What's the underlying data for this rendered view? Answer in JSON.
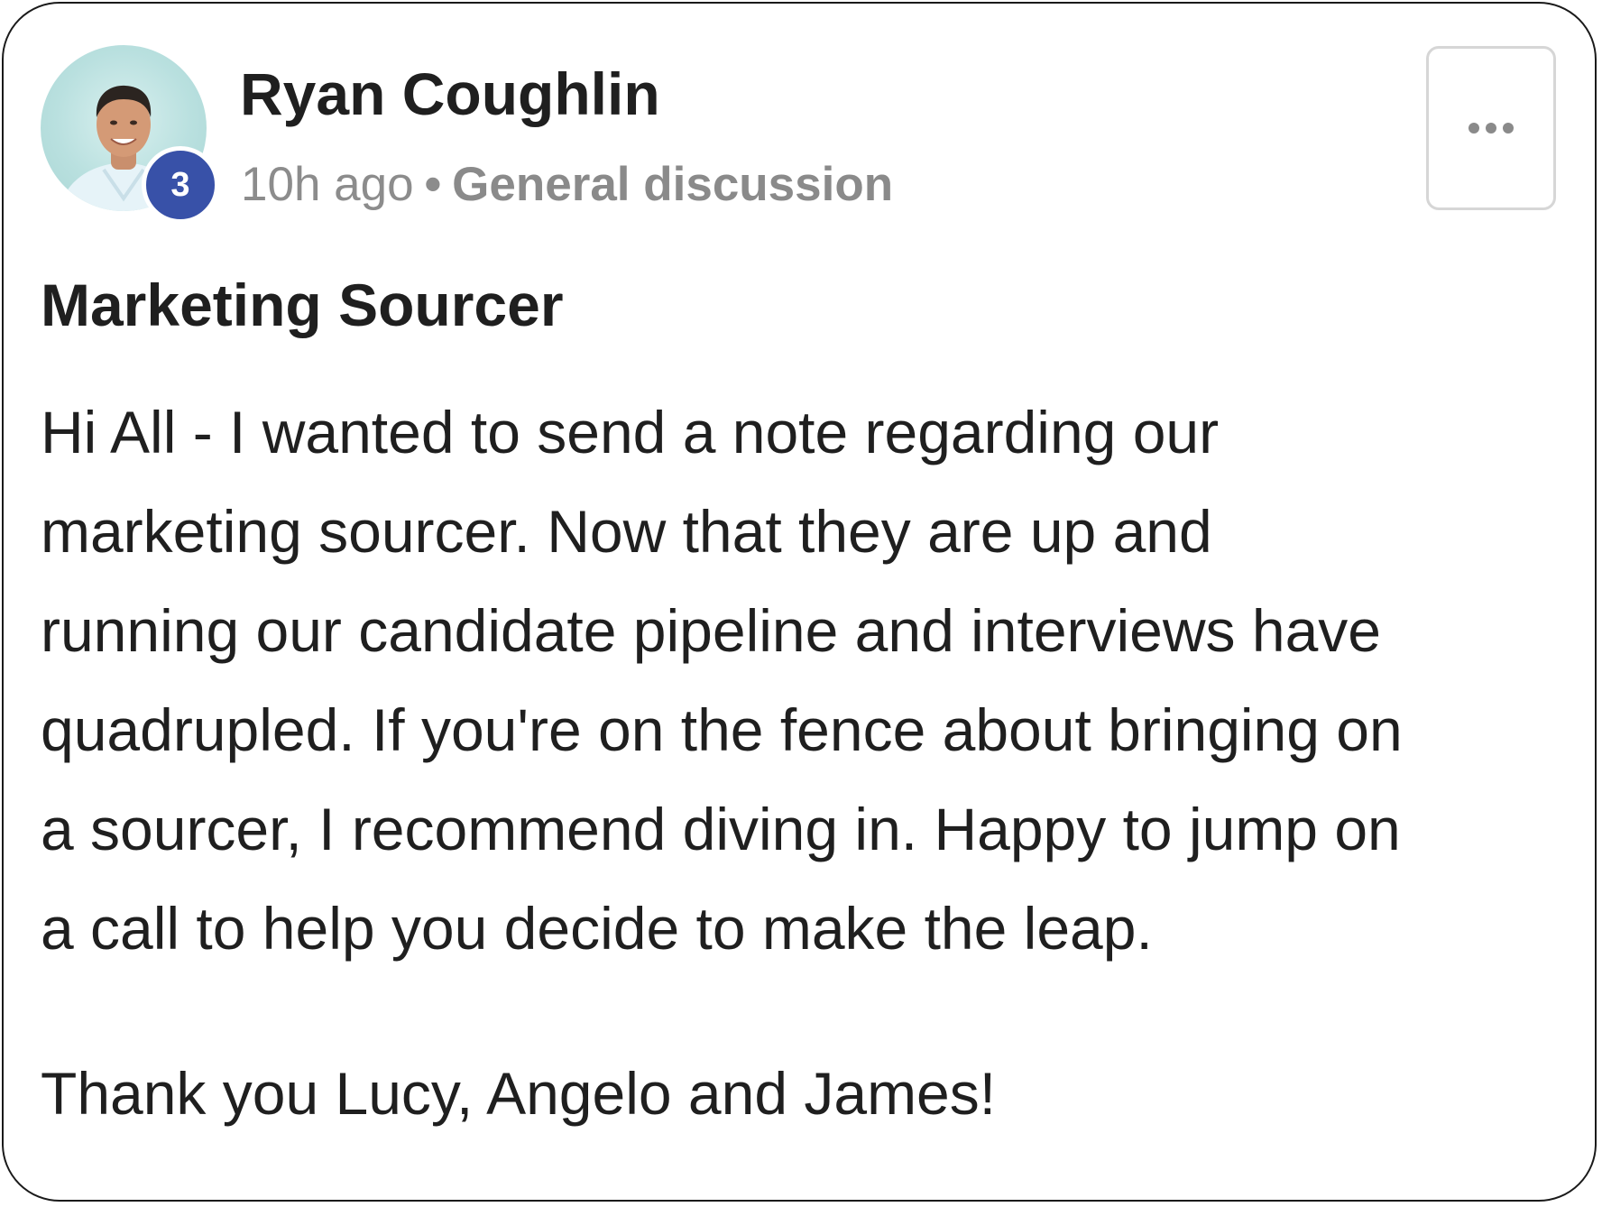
{
  "post": {
    "author": {
      "name": "Ryan Coughlin",
      "avatar": "profile-photo",
      "level": "3"
    },
    "meta": {
      "time": "10h ago",
      "separator": "•",
      "category": "General discussion"
    },
    "menu_icon": "more-horizontal-icon",
    "title": "Marketing Sourcer",
    "body_lines": [
      "Hi All - I wanted to send a note regarding our",
      "marketing sourcer. Now that they are up and",
      "running our candidate pipeline and interviews have",
      "quadrupled. If you're on the fence about bringing on",
      "a sourcer, I recommend diving in. Happy to jump on",
      "a call to help you decide to make the leap."
    ],
    "closing": "Thank you Lucy, Angelo and James!"
  },
  "colors": {
    "level_badge": "#3851a8",
    "meta_text": "#8c8c8c",
    "text": "#1f1f1f"
  }
}
